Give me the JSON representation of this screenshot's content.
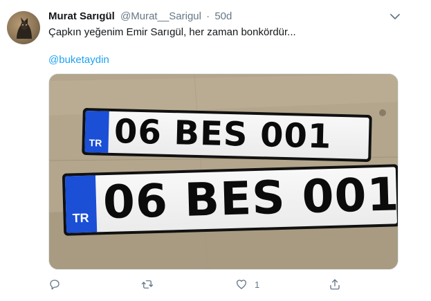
{
  "tweet": {
    "author_name": "Murat Sarıgül",
    "author_handle": "@Murat__Sarigul",
    "separator": "·",
    "timestamp": "50d",
    "text": "Çapkın yeğenim Emir Sarıgül, her zaman bonkördür...",
    "mention": "@buketaydin"
  },
  "media": {
    "plates": [
      {
        "country": "TR",
        "registration": "06 BES 001"
      },
      {
        "country": "TR",
        "registration": "06 BES 001"
      }
    ]
  },
  "actions": {
    "reply": {
      "icon": "reply-icon"
    },
    "retweet": {
      "icon": "retweet-icon"
    },
    "like": {
      "icon": "heart-icon",
      "count": "1"
    },
    "share": {
      "icon": "share-icon"
    }
  },
  "colors": {
    "link": "#1da1f2",
    "secondary_text": "#657786",
    "plate_blue": "#1a4fd6"
  }
}
